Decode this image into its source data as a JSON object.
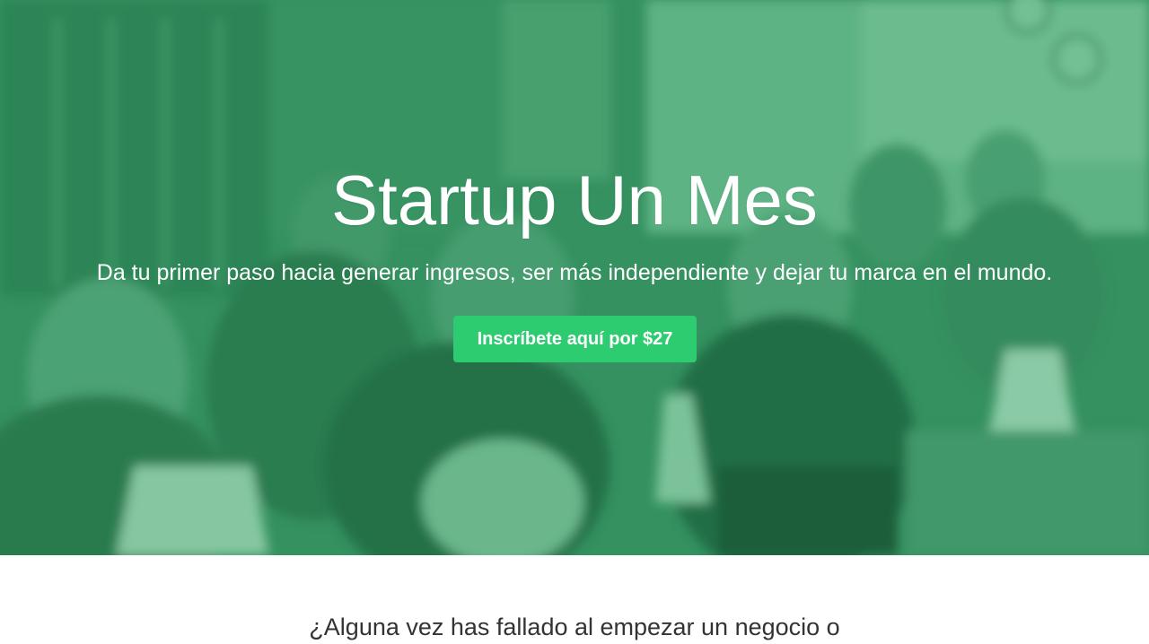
{
  "hero": {
    "title": "Startup Un Mes",
    "subtitle": "Da tu primer paso hacia generar ingresos, ser más independiente y dejar tu marca en el mundo.",
    "cta_label": "Inscríbete aquí por $27",
    "background_description_icon": "blurred-photo-of-people-working",
    "overlay_color": "#2a8a58",
    "button_color": "#2ecc71"
  },
  "intro": {
    "text": "¿Alguna vez has fallado al empezar un negocio o"
  }
}
